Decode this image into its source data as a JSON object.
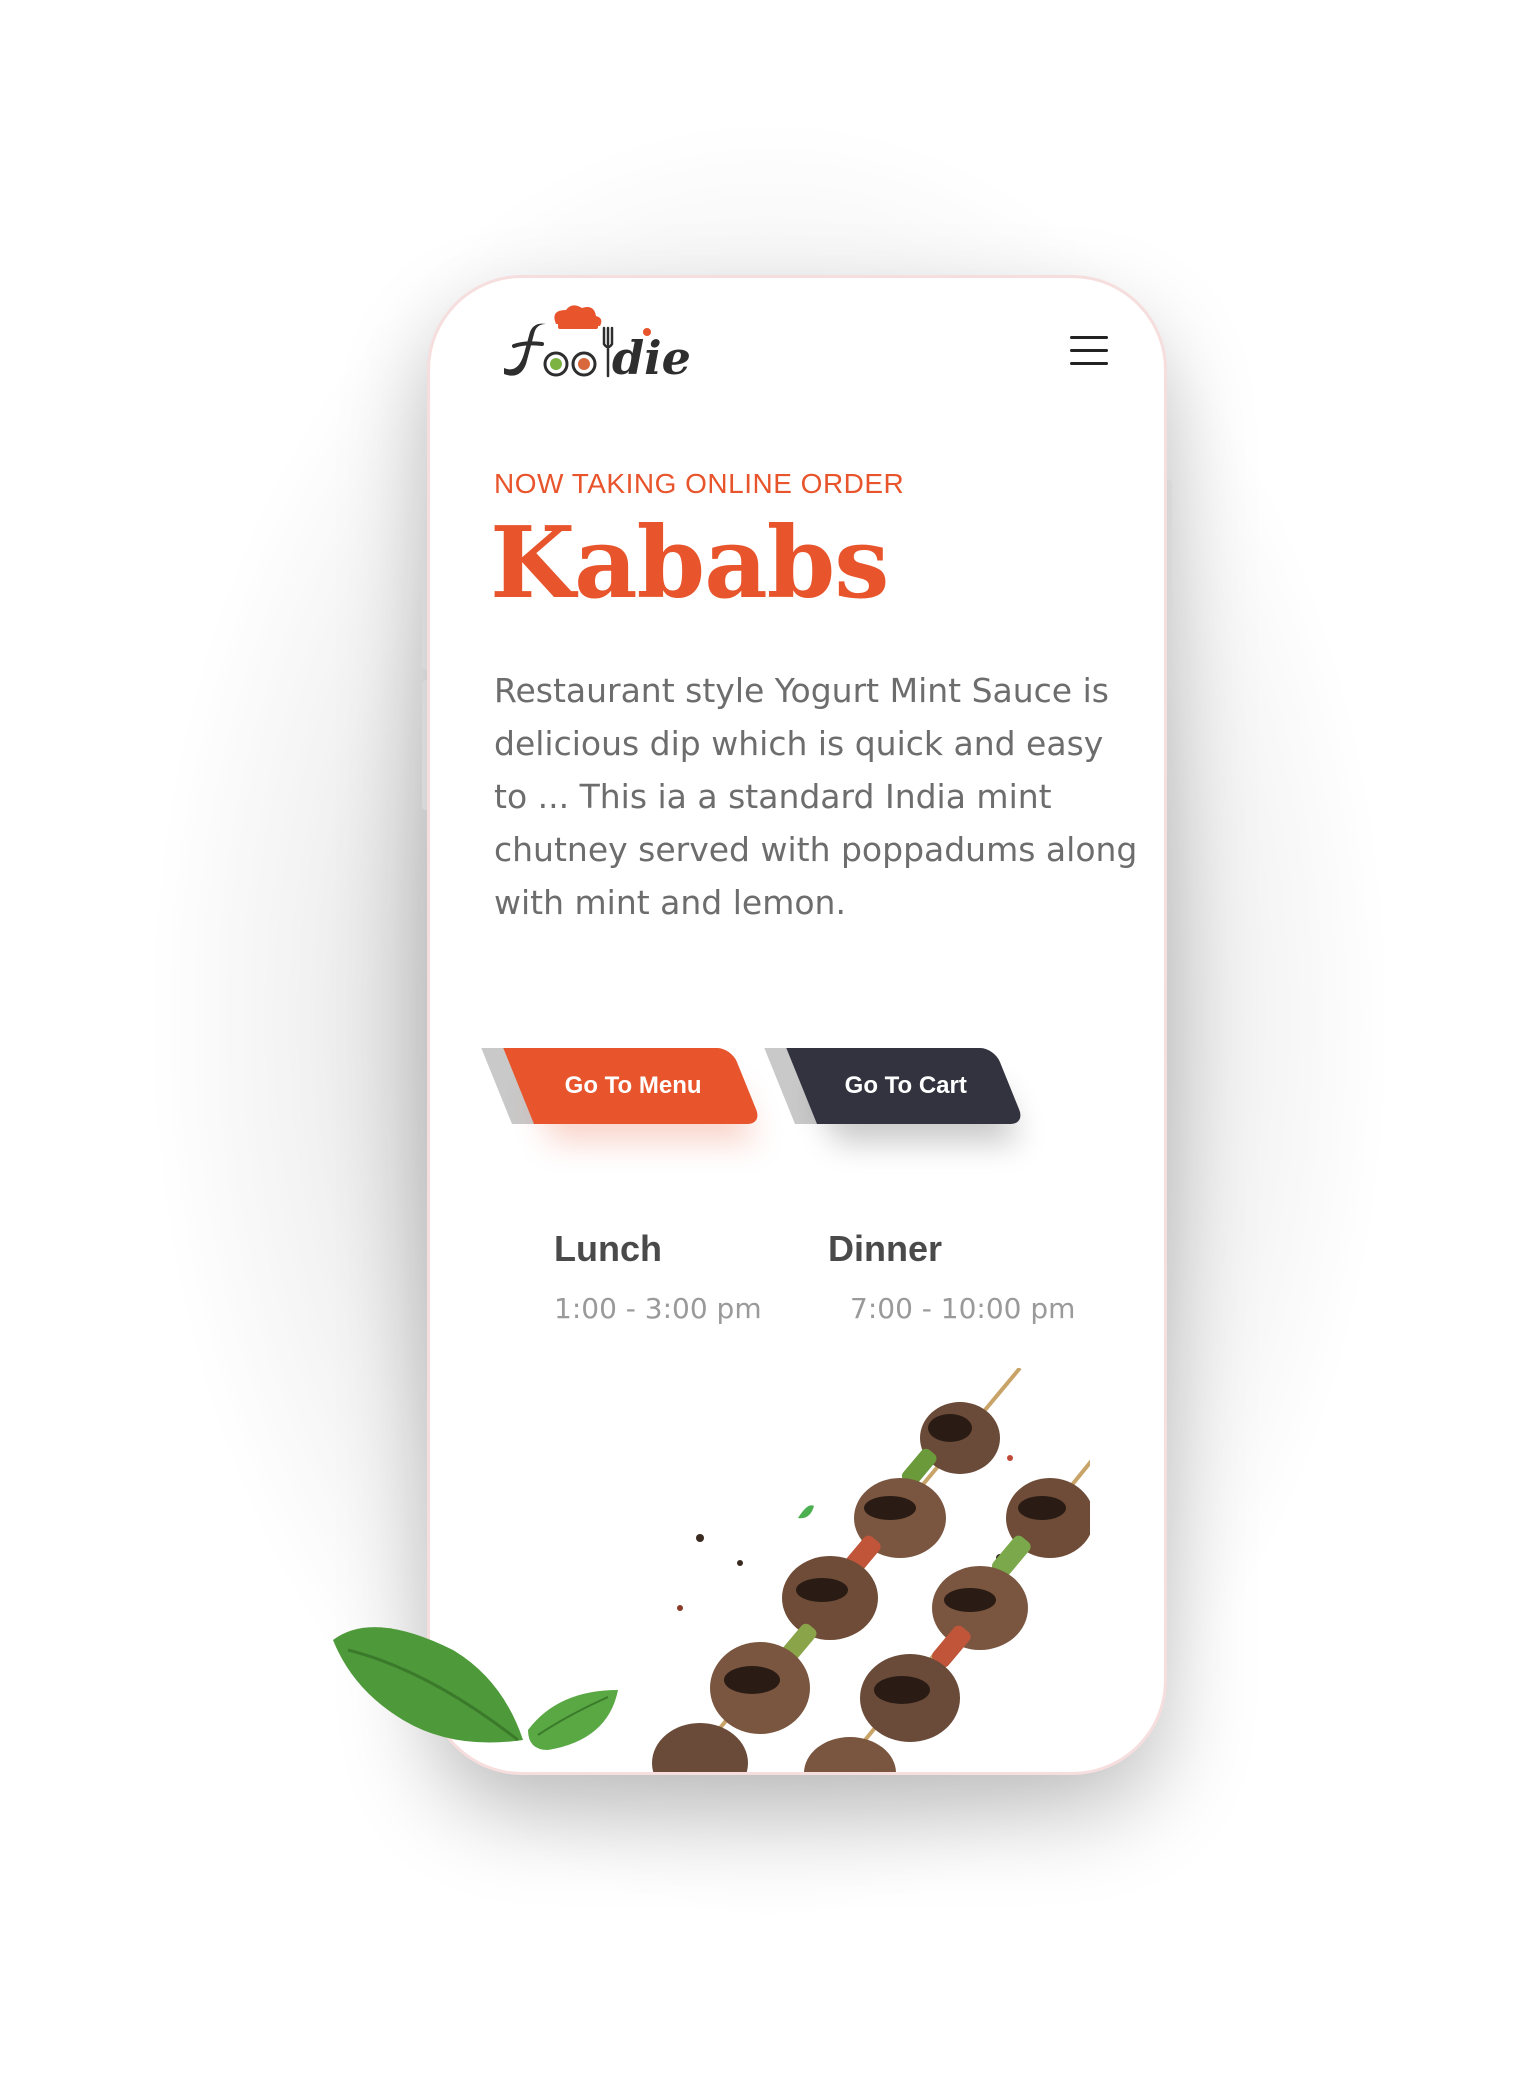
{
  "brand": {
    "logo_text": "Foodie",
    "accent_color": "#e8542b",
    "dark_color": "#33333f"
  },
  "header": {
    "menu_icon": "hamburger-menu-icon"
  },
  "hero": {
    "eyebrow": "NOW TAKING ONLINE ORDER",
    "title": "Kababs",
    "description": "Restaurant style Yogurt Mint Sauce is delicious dip which is quick and easy to ... This ia a standard India mint chutney served with poppadums along with mint and lemon."
  },
  "actions": {
    "menu_label": "Go To Menu",
    "cart_label": "Go To Cart"
  },
  "hours": [
    {
      "meal": "Lunch",
      "time": "1:00 - 3:00 pm"
    },
    {
      "meal": "Dinner",
      "time": "7:00 - 10:00 pm"
    }
  ],
  "images": {
    "kabab": "kabab-skewers-image",
    "leaf": "mint-leaves-image"
  }
}
